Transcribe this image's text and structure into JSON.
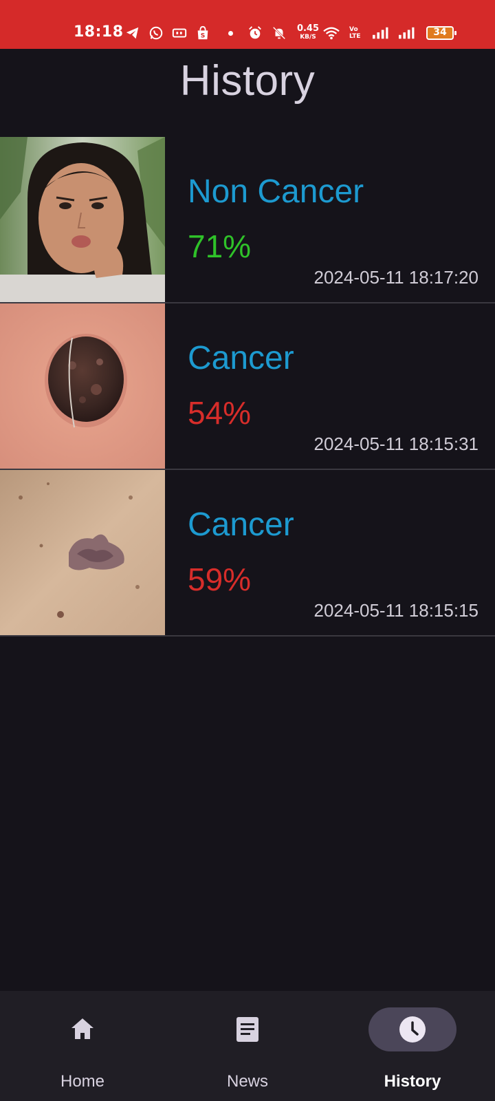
{
  "status_bar": {
    "time": "18:18",
    "net_speed_value": "0.45",
    "net_speed_unit": "KB/S",
    "volte_label": "Vo LTE",
    "battery": "34",
    "icons": [
      "telegram-icon",
      "whatsapp-icon",
      "cast-icon",
      "shop-icon",
      "dot-icon",
      "alarm-icon",
      "mute-icon",
      "wifi-icon",
      "signal-icon",
      "signal-icon",
      "battery-icon"
    ]
  },
  "header": {
    "title": "History"
  },
  "history": [
    {
      "label": "Non Cancer",
      "percent": "71%",
      "timestamp": "2024-05-11 18:17:20",
      "percent_color": "#2fc229"
    },
    {
      "label": "Cancer",
      "percent": "54%",
      "timestamp": "2024-05-11 18:15:31",
      "percent_color": "#d72d2a"
    },
    {
      "label": "Cancer",
      "percent": "59%",
      "timestamp": "2024-05-11 18:15:15",
      "percent_color": "#d72d2a"
    }
  ],
  "nav": {
    "items": [
      {
        "label": "Home",
        "icon": "home-icon"
      },
      {
        "label": "News",
        "icon": "news-icon"
      },
      {
        "label": "History",
        "icon": "clock-icon"
      }
    ],
    "active": "History"
  },
  "colors": {
    "status_bar": "#d52a29",
    "background": "#15131a",
    "label": "#1d9ad0",
    "nav_background": "#201e25",
    "active_pill": "#4b4659"
  }
}
